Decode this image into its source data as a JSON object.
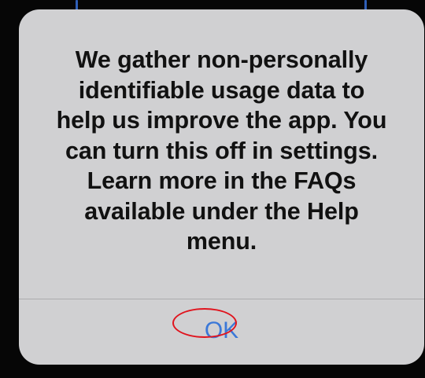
{
  "dialog": {
    "message_lines": [
      "We gather non-personally",
      "identifiable usage data to",
      "help us improve the app. You",
      "can turn this off in settings.",
      "Learn more in the FAQs",
      "available under the Help",
      "menu."
    ],
    "ok_label": "OK"
  },
  "colors": {
    "dialog_background": "#d0d0d2",
    "message_text": "#111111",
    "button_text": "#3b78d8",
    "highlight_ring": "#e0141e",
    "screen_background": "#060606"
  }
}
